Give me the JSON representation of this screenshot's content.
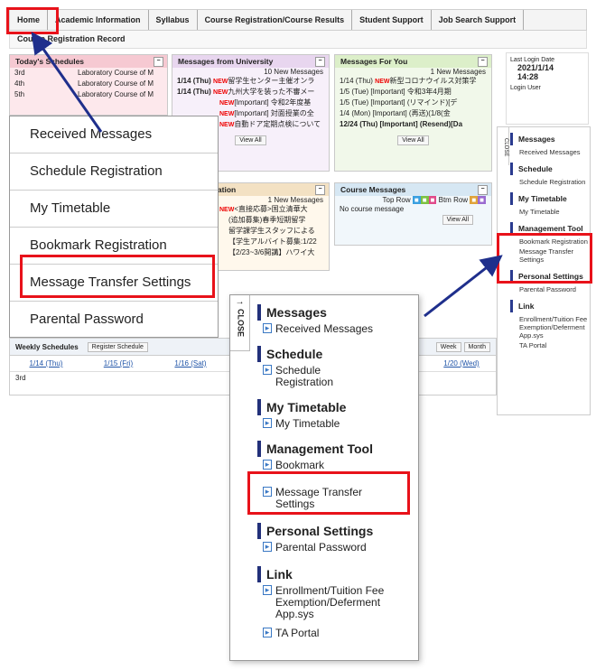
{
  "nav": {
    "tabs": [
      "Home",
      "Academic Information",
      "Syllabus",
      "Course Registration/Course Results",
      "Student Support",
      "Job Search Support"
    ],
    "sub": "Course Registration Record"
  },
  "schedules": {
    "title": "Today's Schedules",
    "rows": [
      {
        "period": "3rd",
        "course": "Laboratory Course of M"
      },
      {
        "period": "4th",
        "course": "Laboratory Course of M"
      },
      {
        "period": "5th",
        "course": "Laboratory Course of M"
      }
    ]
  },
  "uni_messages": {
    "title": "Messages from University",
    "count": "10 New Messages",
    "rows": [
      {
        "date": "1/14 (Thu)",
        "new": "NEW",
        "text": "留学生センター主催オンラ"
      },
      {
        "date": "1/14 (Thu)",
        "new": "NEW",
        "text": "九州大学を装った不審メー"
      },
      {
        "date": "",
        "new": "NEW",
        "text": "[Important] 令和2年度基"
      },
      {
        "date": "",
        "new": "NEW",
        "text": "[Important] 対面授業の全"
      },
      {
        "date": "",
        "new": "NEW",
        "text": "自動ドア定期点検について"
      }
    ]
  },
  "your_messages": {
    "title": "Messages For You",
    "count": "1 New Messages",
    "rows": [
      {
        "date": "1/14 (Thu)",
        "new": "NEW",
        "text": "新型コロナウイルス対策学"
      },
      {
        "date": "1/5 (Tue)",
        "new": "",
        "text": "[Important] 令和3年4月期"
      },
      {
        "date": "1/5 (Tue)",
        "new": "",
        "text": "[Important] (リマインド)[デ"
      },
      {
        "date": "1/4 (Mon)",
        "new": "",
        "text": "[Important] (再送)(1/8(金"
      },
      {
        "date": "12/24 (Thu)",
        "new": "",
        "text": "[Important] (Resend)[Da"
      }
    ],
    "viewall": "View All"
  },
  "upload": {
    "title": "oad information",
    "count": "1 New Messages",
    "rows": [
      {
        "new": "NEW",
        "text": "<直接応募>国立清華大"
      },
      {
        "new": "",
        "text": "(追加募集)春季短期留学"
      },
      {
        "new": "",
        "text": "留学課学生スタッフによる"
      },
      {
        "new": "",
        "text": "【学生アルバイト募集:1/22"
      },
      {
        "new": "",
        "text": "【2/23~3/6開講】ハワイ大"
      }
    ],
    "viewall": "View All"
  },
  "course_messages": {
    "title": "Course Messages",
    "toprow": "Top Row",
    "btmrow": "Btm Row",
    "empty": "No course message",
    "viewall": "View All"
  },
  "viewall_uni": "View All",
  "login": {
    "label": "Last Login Date",
    "date": "2021/1/14",
    "time": "14:28",
    "user": "Login User"
  },
  "sidebar": {
    "close": "CLOSE",
    "sections": [
      {
        "title": "Messages",
        "items": [
          "Received Messages"
        ]
      },
      {
        "title": "Schedule",
        "items": [
          "Schedule Registration"
        ]
      },
      {
        "title": "My Timetable",
        "items": [
          "My Timetable"
        ]
      },
      {
        "title": "Management Tool",
        "items": [
          "Bookmark Registration",
          "Message Transfer Settings"
        ]
      },
      {
        "title": "Personal Settings",
        "items": [
          "Parental Password"
        ]
      },
      {
        "title": "Link",
        "items": [
          "Enrollment/Tuition Fee Exemption/Deferment App.sys",
          "TA Portal"
        ]
      }
    ]
  },
  "popup": {
    "items": [
      "Received Messages",
      "Schedule Registration",
      "My Timetable",
      "Bookmark Registration",
      "Message Transfer Settings",
      "Parental Password"
    ]
  },
  "bigpanel": {
    "close": "CLOSE",
    "sections": [
      {
        "title": "Messages",
        "items": [
          "Received Messages"
        ]
      },
      {
        "title": "Schedule",
        "items": [
          "Schedule Registration"
        ]
      },
      {
        "title": "My Timetable",
        "items": [
          "My Timetable"
        ]
      },
      {
        "title": "Management Tool",
        "items": [
          "Bookmark Registration",
          "Message Transfer Settings"
        ]
      },
      {
        "title": "Personal Settings",
        "items": [
          "Parental Password"
        ]
      },
      {
        "title": "Link",
        "items": [
          "Enrollment/Tuition Fee Exemption/Deferment App.sys",
          "TA Portal"
        ]
      }
    ]
  },
  "weekly": {
    "title": "Weekly Schedules",
    "register": "Register Schedule",
    "week": "Week",
    "month": "Month",
    "days": [
      "1/14 (Thu)",
      "1/15 (Fri)",
      "1/16 (Sat)",
      "1/20 (Wed)"
    ],
    "period": "3rd"
  },
  "colors": {
    "highlight": "#e8121a",
    "arrow": "#1f2f8c",
    "accent": "#22307a"
  }
}
